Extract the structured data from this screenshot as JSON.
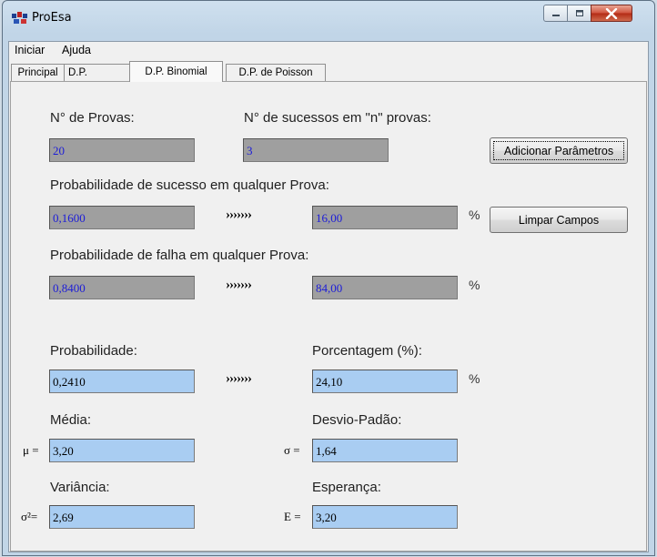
{
  "window": {
    "title": "ProEsa"
  },
  "menu": {
    "items": [
      "Iniciar",
      "Ajuda"
    ]
  },
  "tabs": [
    "Principal",
    "D.P.",
    "D.P. Binomial",
    "D.P. de Poisson"
  ],
  "active_tab": "D.P. Binomial",
  "form": {
    "n_provas_label": "N° de Provas:",
    "n_provas_value": "20",
    "n_sucessos_label": "N° de sucessos em \"n\" provas:",
    "n_sucessos_value": "3",
    "add_button": "Adicionar Parâmetros",
    "prob_sucesso_label": "Probabilidade de sucesso em qualquer Prova:",
    "prob_sucesso_value": "0,1600",
    "prob_sucesso_pct": "16,00",
    "clear_button": "Limpar Campos",
    "prob_falha_label": "Probabilidade de falha em qualquer Prova:",
    "prob_falha_value": "0,8400",
    "prob_falha_pct": "84,00",
    "probabilidade_label": "Probabilidade:",
    "probabilidade_value": "0,2410",
    "porcentagem_label": "Porcentagem (%):",
    "porcentagem_value": "24,10",
    "media_label": "Média:",
    "media_symbol": "μ =",
    "media_value": "3,20",
    "desvio_label": "Desvio-Padão:",
    "desvio_symbol": "σ =",
    "desvio_value": "1,64",
    "variancia_label": "Variância:",
    "variancia_symbol": "σ²=",
    "variancia_value": "2,69",
    "esperanca_label": "Esperança:",
    "esperanca_symbol": "E =",
    "esperanca_value": "3,20",
    "arrows": "›››››››",
    "percent_sign": "%"
  },
  "colors": {
    "readonly_field": "#9f9f9f",
    "readonly_text": "#1c1cd8",
    "result_field": "#a9cdf2",
    "close_button": "#c9432b"
  }
}
